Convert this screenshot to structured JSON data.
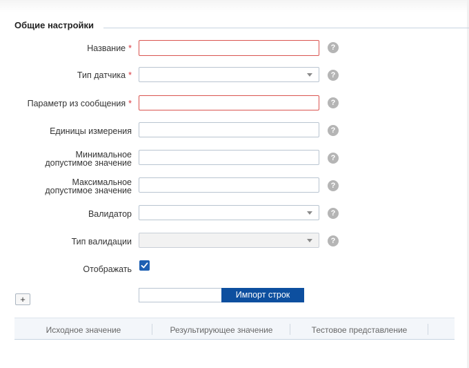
{
  "section": {
    "title": "Общие настройки"
  },
  "fields": {
    "name": {
      "label": "Название",
      "required": true
    },
    "sensor_type": {
      "label": "Тип датчика",
      "required": true
    },
    "message_param": {
      "label": "Параметр из сообщения",
      "required": true
    },
    "units": {
      "label": "Единицы измерения",
      "required": false
    },
    "min_value": {
      "label_line1": "Минимальное",
      "label_line2": "допустимое значение"
    },
    "max_value": {
      "label_line1": "Максимальное",
      "label_line2": "допустимое значение"
    },
    "validator": {
      "label": "Валидатор"
    },
    "validation_type": {
      "label": "Тип валидации"
    },
    "display": {
      "label": "Отображать",
      "checked": true
    }
  },
  "required_mark": "*",
  "help_glyph": "?",
  "add_row_label": "+",
  "import": {
    "button_label": "Импорт строк"
  },
  "table": {
    "columns": [
      "Исходное значение",
      "Результирующее значение",
      "Тестовое представление"
    ]
  },
  "colors": {
    "accent": "#0d4f9f",
    "error_border": "#d9534f",
    "required": "#d9363e"
  }
}
